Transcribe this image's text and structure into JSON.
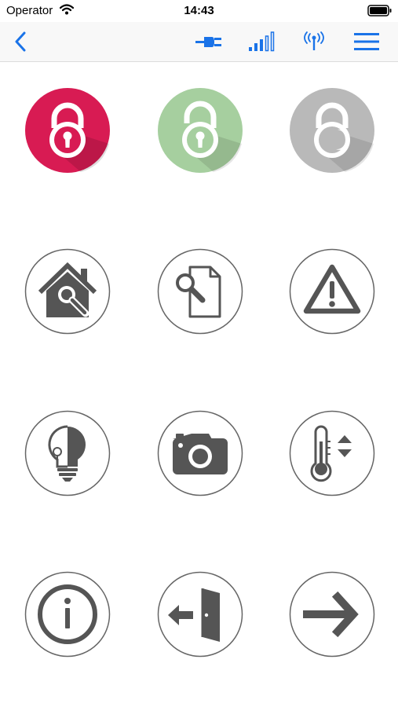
{
  "status_bar": {
    "carrier": "Operator",
    "time": "14:43"
  },
  "nav_bar": {
    "back_icon": "chevron-left-icon",
    "actions": [
      "plug-icon",
      "signal-strength-icon",
      "antenna-icon",
      "menu-icon"
    ],
    "accent_color": "#1a73e8"
  },
  "grid": {
    "buttons": [
      {
        "icon": "lock-closed-icon",
        "color": "#d81b53"
      },
      {
        "icon": "lock-open-icon",
        "color": "#a6cf9f"
      },
      {
        "icon": "lock-unknown-icon",
        "color": "#b9b9b9"
      },
      {
        "icon": "house-search-icon"
      },
      {
        "icon": "document-search-icon"
      },
      {
        "icon": "warning-icon"
      },
      {
        "icon": "lightbulb-icon"
      },
      {
        "icon": "camera-icon"
      },
      {
        "icon": "thermometer-icon"
      },
      {
        "icon": "info-icon"
      },
      {
        "icon": "exit-door-icon"
      },
      {
        "icon": "arrow-right-icon"
      }
    ]
  }
}
